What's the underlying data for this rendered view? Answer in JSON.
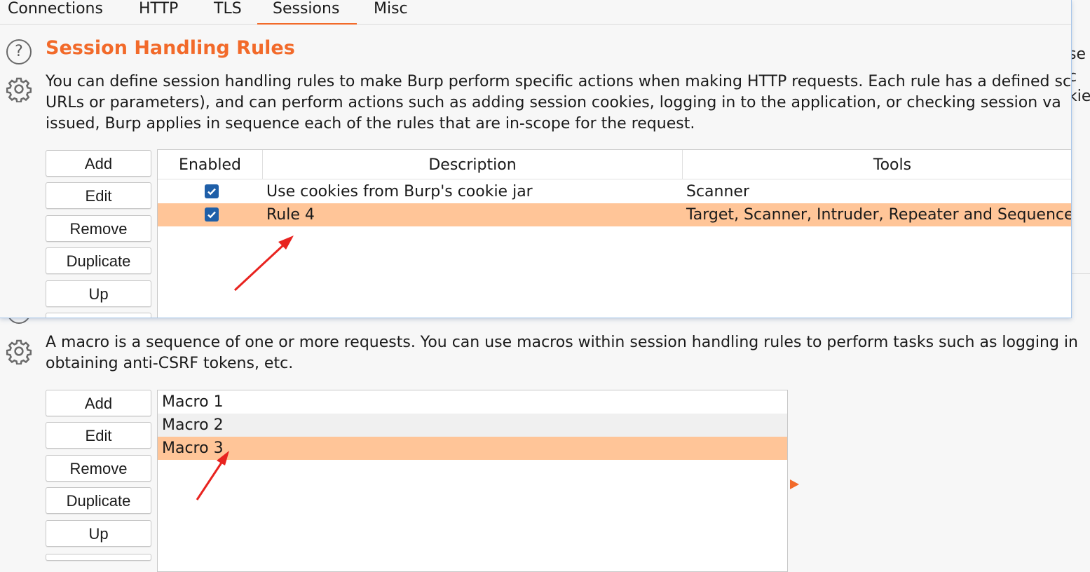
{
  "tabs": [
    {
      "label": "Connections",
      "active": false
    },
    {
      "label": "HTTP",
      "active": false
    },
    {
      "label": "TLS",
      "active": false
    },
    {
      "label": "Sessions",
      "active": true
    },
    {
      "label": "Misc",
      "active": false
    }
  ],
  "background_fragment": {
    "line1": "se c",
    "line2": "kie"
  },
  "session_rules": {
    "help_icon": "help-icon",
    "settings_icon": "gear-icon",
    "title": "Session Handling Rules",
    "description_lines": [
      "You can define session handling rules to make Burp perform specific actions when making HTTP requests. Each rule has a defined sc",
      "URLs or parameters), and can perform actions such as adding session cookies, logging in to the application, or checking session va",
      "issued, Burp applies in sequence each of the rules that are in-scope for the request."
    ],
    "buttons": {
      "add": "Add",
      "edit": "Edit",
      "remove": "Remove",
      "duplicate": "Duplicate",
      "up": "Up"
    },
    "table": {
      "columns": [
        "Enabled",
        "Description",
        "Tools"
      ],
      "rows": [
        {
          "enabled": true,
          "description": "Use cookies from Burp's cookie jar",
          "tools": "Scanner",
          "selected": false
        },
        {
          "enabled": true,
          "description": "Rule 4",
          "tools": "Target, Scanner, Intruder, Repeater and Sequencer",
          "selected": true
        }
      ]
    }
  },
  "macros": {
    "settings_icon": "gear-icon",
    "description_lines": [
      "A macro is a sequence of one or more requests. You can use macros within session handling rules to perform tasks such as logging in",
      "obtaining anti-CSRF tokens, etc."
    ],
    "buttons": {
      "add": "Add",
      "edit": "Edit",
      "remove": "Remove",
      "duplicate": "Duplicate",
      "up": "Up"
    },
    "items": [
      {
        "label": "Macro 1",
        "selected": false
      },
      {
        "label": "Macro 2",
        "selected": false
      },
      {
        "label": "Macro 3",
        "selected": true
      }
    ]
  },
  "colors": {
    "accent": "#f26a2a",
    "selection": "#ffc598",
    "checkbox": "#1f5fa8",
    "annotation_arrow": "#e8231f"
  }
}
